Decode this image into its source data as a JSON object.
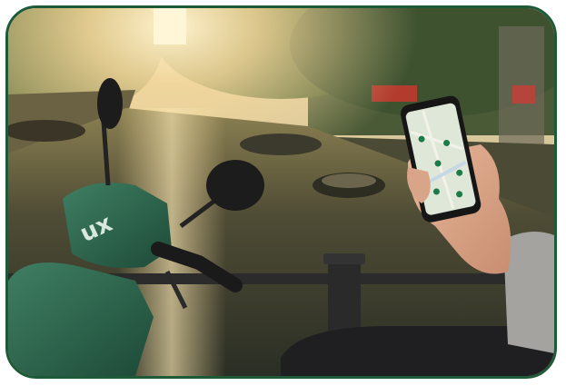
{
  "photo": {
    "scooter_brand_text": "ux",
    "colors": {
      "frame_border": "#1f5a38",
      "scooter_green": "#2f6a52",
      "sunlight": "#f3d79a",
      "water_dark": "#2a2e24",
      "phone_map": "#dfe8d8",
      "map_pin": "#1f7a4a"
    }
  }
}
